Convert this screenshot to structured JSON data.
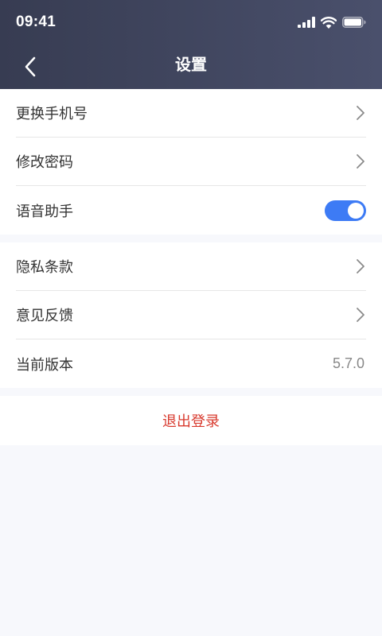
{
  "status_bar": {
    "time": "09:41",
    "icons": [
      "cellular-signal-icon",
      "wifi-icon",
      "battery-icon"
    ]
  },
  "nav": {
    "title": "设置",
    "back_icon": "chevron-left-icon"
  },
  "groups": [
    {
      "items": [
        {
          "label": "更换手机号",
          "accessory": "chevron-right-icon"
        },
        {
          "label": "修改密码",
          "accessory": "chevron-right-icon"
        },
        {
          "label": "语音助手",
          "accessory": "toggle",
          "toggle_on": true
        }
      ]
    },
    {
      "items": [
        {
          "label": "隐私条款",
          "accessory": "chevron-right-icon"
        },
        {
          "label": "意见反馈",
          "accessory": "chevron-right-icon"
        },
        {
          "label": "当前版本",
          "value": "5.7.0"
        }
      ]
    }
  ],
  "logout": {
    "label": "退出登录"
  },
  "colors": {
    "header_start": "#373c52",
    "header_end": "#4a506c",
    "page_background": "#f7f8fc",
    "toggle_on": "#3d7bf5",
    "logout_text": "#d83a2e"
  }
}
